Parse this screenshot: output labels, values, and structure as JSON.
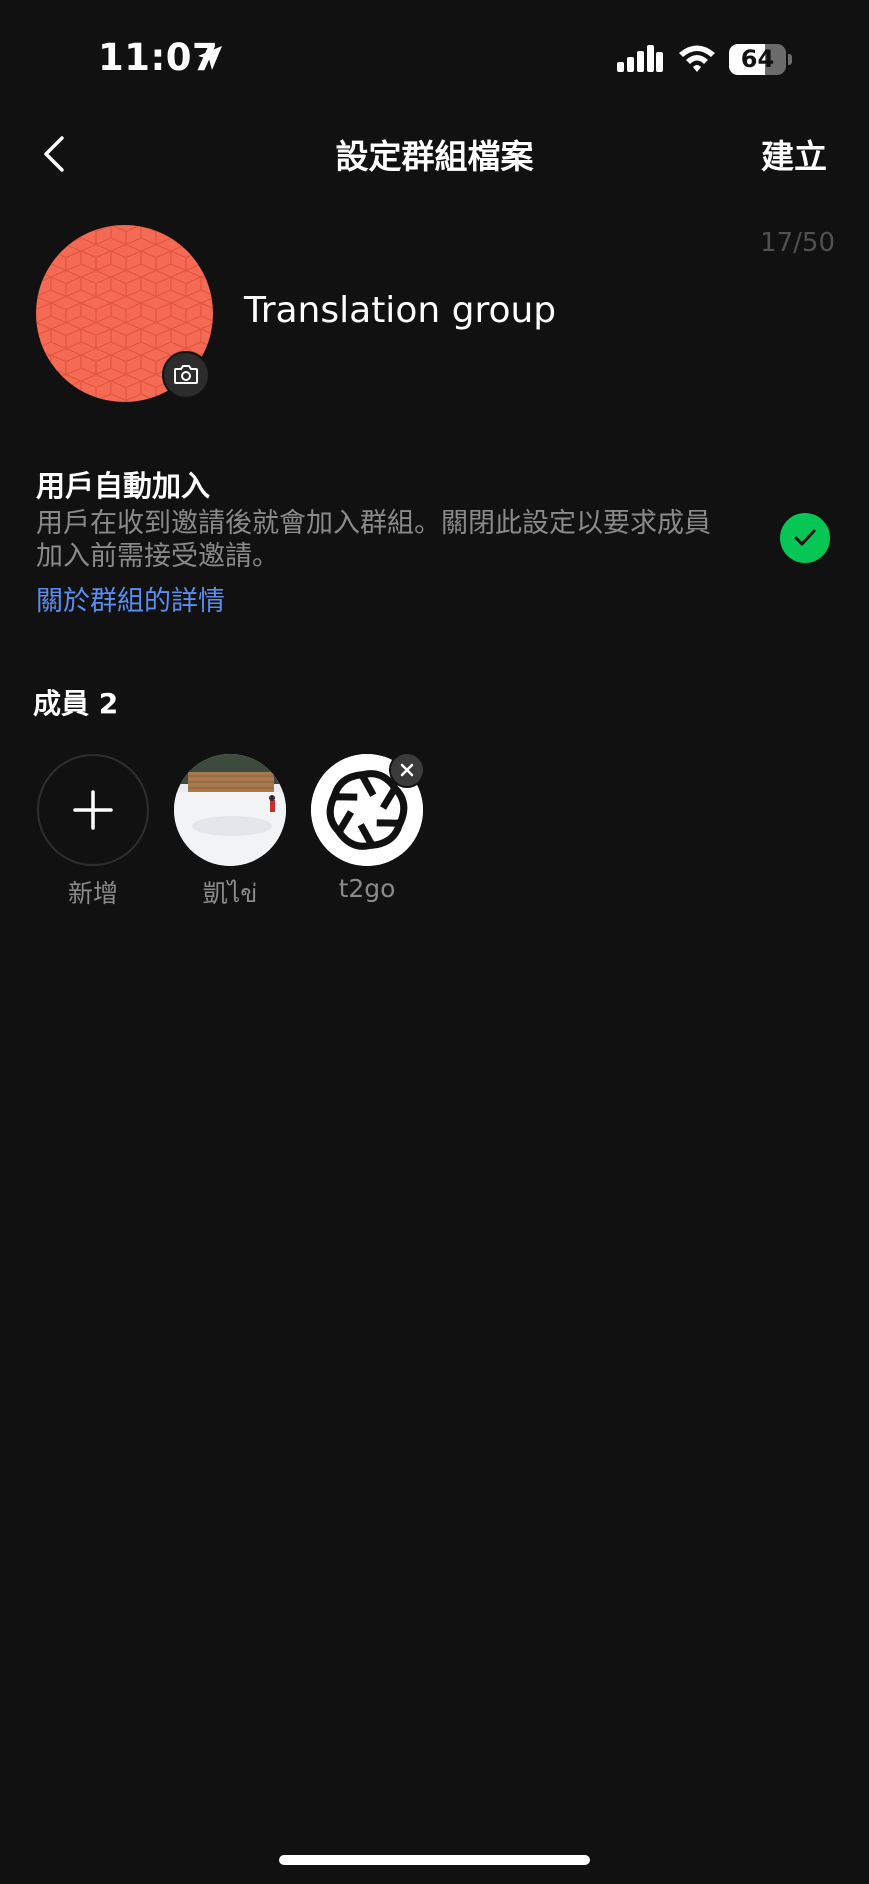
{
  "status_bar": {
    "time": "11:07",
    "battery_level": "64",
    "battery_fraction": 0.64
  },
  "nav": {
    "title": "設定群組檔案",
    "create_label": "建立"
  },
  "group": {
    "name": "Translation group",
    "char_count": "17/50",
    "avatar_color": "#f46a54"
  },
  "auto_join": {
    "title": "用戶自動加入",
    "description": "用戶在收到邀請後就會加入群組。關閉此設定以要求成員加入前需接受邀請。",
    "link": "關於群組的詳情",
    "enabled": true,
    "accent_color": "#06c755"
  },
  "members": {
    "label": "成員 2",
    "add_label": "新增",
    "items": [
      {
        "name": "凱ไข่",
        "avatar": "snow-photo"
      },
      {
        "name": "t2go",
        "avatar": "openai-logo"
      }
    ]
  },
  "icons": [
    "location-arrow-icon",
    "signal-icon",
    "wifi-icon",
    "battery-icon",
    "back-chevron-icon",
    "camera-icon",
    "check-icon",
    "plus-icon",
    "close-icon"
  ]
}
